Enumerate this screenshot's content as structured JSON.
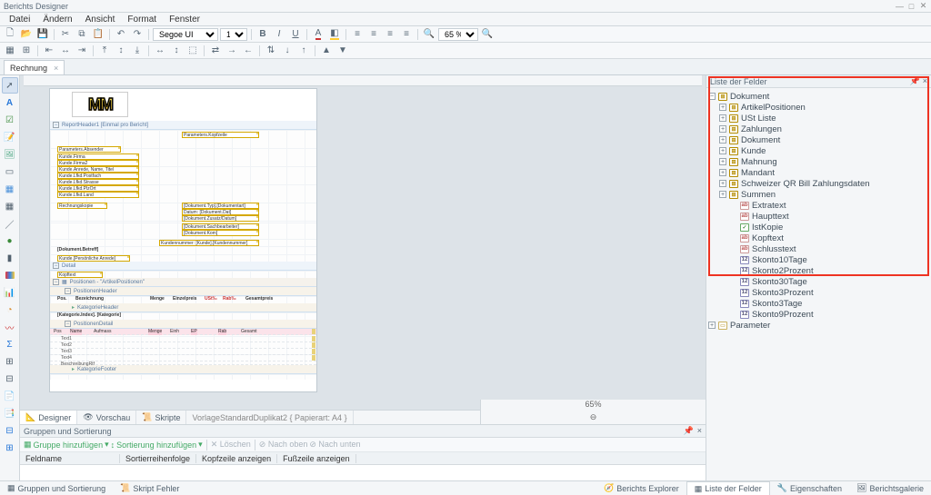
{
  "title": "Berichts Designer",
  "menu": {
    "items": [
      "Datei",
      "Ändern",
      "Ansicht",
      "Format",
      "Fenster"
    ]
  },
  "toolbar": {
    "font": "Segoe UI",
    "fontsize": "10",
    "zoom": "65 %"
  },
  "doctab": {
    "name": "Rechnung"
  },
  "ctabs": {
    "designer": "Designer",
    "preview": "Vorschau",
    "scripts": "Skripte",
    "template": "VorlageStandardDuplikat2 { Papierart: A4 }",
    "zoom": "65%"
  },
  "groups": {
    "title": "Gruppen und Sortierung",
    "addgroup": "Gruppe hinzufügen",
    "addsort": "Sortierung hinzufügen",
    "delete": "Löschen",
    "up": "Nach oben",
    "down": "Nach unten",
    "cols": [
      "Feldname",
      "Sortierreihenfolge",
      "Kopfzeile anzeigen",
      "Fußzeile anzeigen"
    ]
  },
  "fieldlist": {
    "title": "Liste der Felder",
    "root": "Dokument",
    "tables": [
      "ArtikelPositionen",
      "USt Liste",
      "Zahlungen",
      "Dokument",
      "Kunde",
      "Mahnung",
      "Mandant",
      "Schweizer QR Bill Zahlungsdaten",
      "Summen"
    ],
    "fields": [
      {
        "name": "Extratext",
        "t": "txt"
      },
      {
        "name": "Haupttext",
        "t": "txt"
      },
      {
        "name": "IstKopie",
        "t": "chk"
      },
      {
        "name": "Kopftext",
        "t": "txt"
      },
      {
        "name": "Schlusstext",
        "t": "txt"
      },
      {
        "name": "Skonto10Tage",
        "t": "num"
      },
      {
        "name": "Skonto2Prozent",
        "t": "num"
      },
      {
        "name": "Skonto30Tage",
        "t": "num"
      },
      {
        "name": "Skonto3Prozent",
        "t": "num"
      },
      {
        "name": "Skonto3Tage",
        "t": "num"
      },
      {
        "name": "Skonto9Prozent",
        "t": "num"
      }
    ],
    "param": "Parameter"
  },
  "footer": {
    "left": [
      "Gruppen und Sortierung",
      "Skript Fehler"
    ],
    "right": [
      "Berichts Explorer",
      "Liste der Felder",
      "Eigenschaften",
      "Berichtsgalerie"
    ]
  },
  "page": {
    "reportheader": "ReportHeader1 [Einmal pro Bericht]",
    "paramKopf": "Parameters.Kopfzeile",
    "absender": "Parameters.Absender",
    "kfirma": "Kunde.Firma",
    "kfirma2": "Kunde.Firma2",
    "kname": "Kunde.Anrede, Name, Titel",
    "kpost": "Kunde.Lfkd.Postfach",
    "kstr": "Kunde.Lfkd.Strasse",
    "kplz": "Kunde.Lfkd.PlzOrt",
    "kland": "Kunde.Lfkd.Land",
    "rechnungsk": "Rechnungskopie",
    "dtyp": "[Dokument.Typ].[Dokumentart]",
    "ddat": "Datum: [Dokument.Dat]",
    "dzus": "[Dokument.Zusatz/Datum]",
    "dsach": "[Dokument.Sachbearbeiter]",
    "dkom": "[Dokument.Kom]",
    "dknr": "Kundennummer: [Kunde].[Kundennummer]",
    "betreff": "[Dokument.Betreff]",
    "detail": "Detail",
    "anrede": "Kunde.[Persönliche Anrede]",
    "kopftext": "Kopftext",
    "positionen": "Positionen - \"ArtikelPositionen\"",
    "posheader": "PositionenHeader",
    "colpos": "Pos.",
    "colbez": "Bezeichnung",
    "colmenge": "Menge",
    "colep": "Einzelpreis",
    "colust": "USt‰",
    "colrab": "Rab‰",
    "colgp": "Gesamtpreis",
    "katheader": "KategorieHeader",
    "katidx": "[Kategorie.Index]. [Kategorie]",
    "posdetail": "PositionenDetail",
    "rowname": "Name",
    "rowauf": "Aufmass",
    "rowmenge": "Menge",
    "roweinh": "Einh",
    "rowep": "EP",
    "rowrab": "Rab",
    "rowgp": "Gesamt",
    "text1": "Text1",
    "text2": "Text2",
    "text3": "Text3",
    "text4": "Text4",
    "besch": "BeschreibungRtf",
    "katfooter": "KategorieFooter"
  }
}
